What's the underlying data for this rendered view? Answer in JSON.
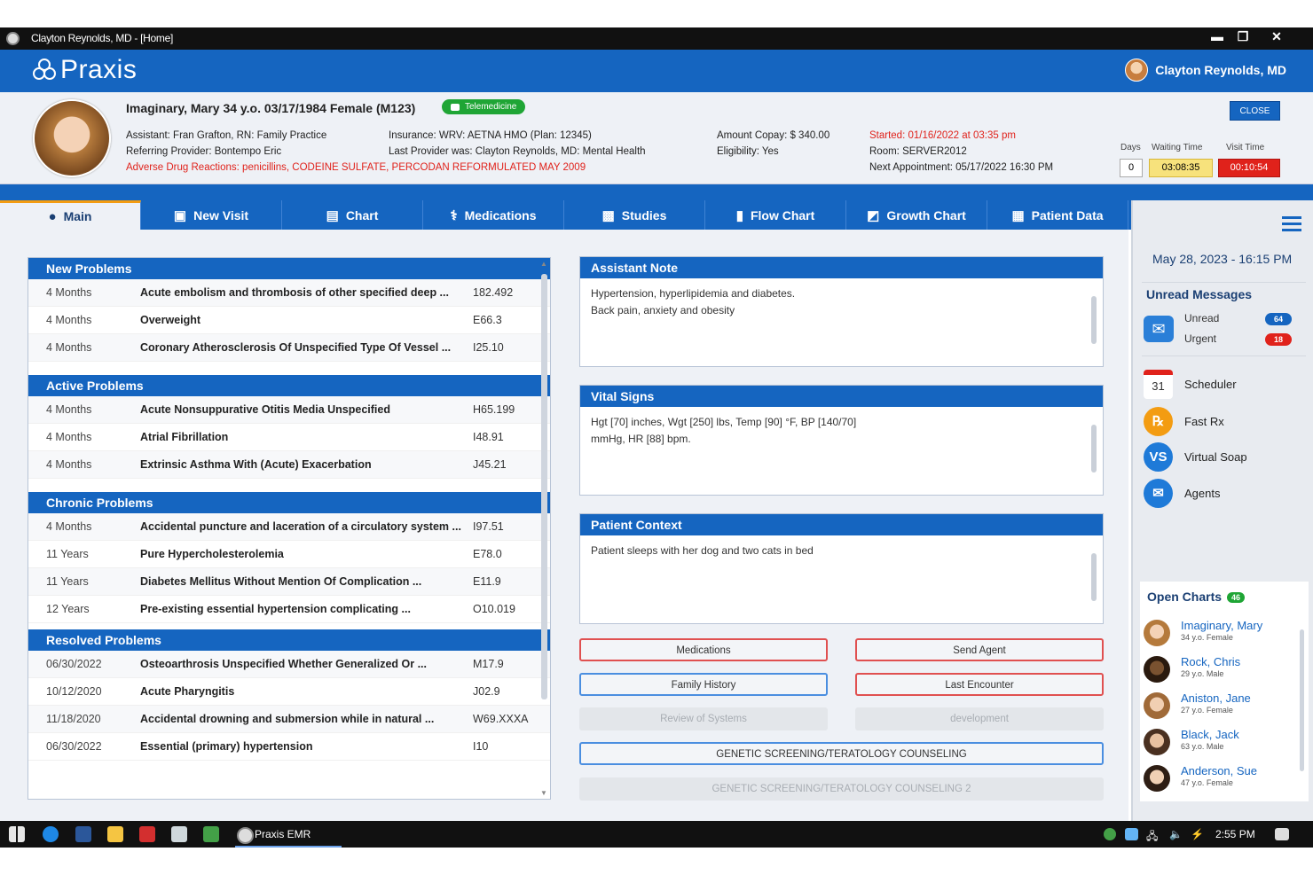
{
  "window": {
    "title": "Clayton Reynolds, MD - [Home]"
  },
  "app": {
    "logo": "Praxis",
    "user": "Clayton Reynolds, MD"
  },
  "patient": {
    "name": "Imaginary, Mary 34 y.o. 03/17/1984 Female (M123)",
    "telemedicine": "Telemedicine",
    "assistant": "Assistant: Fran Grafton, RN: Family Practice",
    "referring": "Referring Provider: Bontempo Eric",
    "adverse_label": "Adverse Drug Reactions:",
    "adverse": "penicillins, CODEINE SULFATE, PERCODAN REFORMULATED MAY 2009",
    "insurance": "Insurance: WRV: AETNA HMO (Plan: 12345)",
    "last_provider": "Last Provider was: Clayton Reynolds, MD: Mental Health",
    "copay": "Amount Copay: $ 340.00",
    "eligibility": "Eligibility: Yes",
    "started": "Started: 01/16/2022 at 03:35 pm",
    "room": "Room: SERVER2012",
    "next_appt": "Next Appointment: 05/17/2022 16:30 PM",
    "close": "CLOSE",
    "days_label": "Days",
    "days": "0",
    "waiting_label": "Waiting Time",
    "waiting": "03:08:35",
    "visit_label": "Visit Time",
    "visit": "00:10:54"
  },
  "tabs": [
    {
      "label": "Main",
      "icon": "user-icon"
    },
    {
      "label": "New Visit",
      "icon": "new-visit-icon"
    },
    {
      "label": "Chart",
      "icon": "chart-icon"
    },
    {
      "label": "Medications",
      "icon": "medications-icon"
    },
    {
      "label": "Studies",
      "icon": "studies-icon"
    },
    {
      "label": "Flow Chart",
      "icon": "bar-chart-icon"
    },
    {
      "label": "Growth Chart",
      "icon": "growth-chart-icon"
    },
    {
      "label": "Patient Data",
      "icon": "id-card-icon"
    }
  ],
  "problems": {
    "new": {
      "title": "New Problems",
      "rows": [
        [
          "4 Months",
          "Acute embolism and thrombosis of other specified deep ...",
          "182.492"
        ],
        [
          "4 Months",
          "Overweight",
          "E66.3"
        ],
        [
          "4 Months",
          "Coronary Atherosclerosis Of Unspecified Type Of Vessel ...",
          "I25.10"
        ]
      ]
    },
    "active": {
      "title": "Active Problems",
      "rows": [
        [
          "4 Months",
          "Acute Nonsuppurative Otitis Media Unspecified",
          "H65.199"
        ],
        [
          "4 Months",
          "Atrial Fibrillation",
          "I48.91"
        ],
        [
          "4 Months",
          "Extrinsic Asthma With (Acute) Exacerbation",
          "J45.21"
        ]
      ]
    },
    "chronic": {
      "title": "Chronic Problems",
      "rows": [
        [
          "4 Months",
          "Accidental puncture and laceration of a circulatory system ...",
          "I97.51"
        ],
        [
          "11 Years",
          "Pure Hypercholesterolemia",
          "E78.0"
        ],
        [
          "11 Years",
          "Diabetes Mellitus Without Mention Of Complication ...",
          "E11.9"
        ],
        [
          "12 Years",
          "Pre-existing essential hypertension complicating ...",
          "O10.019"
        ]
      ]
    },
    "resolved": {
      "title": "Resolved Problems",
      "rows": [
        [
          "06/30/2022",
          "Osteoarthrosis Unspecified Whether Generalized Or ...",
          "M17.9"
        ],
        [
          "10/12/2020",
          "Acute Pharyngitis",
          "J02.9"
        ],
        [
          "11/18/2020",
          "Accidental drowning and submersion while in natural ...",
          "W69.XXXA"
        ],
        [
          "06/30/2022",
          "Essential (primary) hypertension",
          "I10"
        ]
      ]
    }
  },
  "notes": {
    "assistant": {
      "title": "Assistant Note",
      "text1": "Hypertension, hyperlipidemia and diabetes.",
      "text2": "Back pain, anxiety and obesity"
    },
    "vitals": {
      "title": "Vital Signs",
      "text1": "Hgt [70] inches, Wgt [250] lbs, Temp [90] °F, BP [140/70]",
      "text2": "mmHg, HR [88] bpm."
    },
    "context": {
      "title": "Patient Context",
      "text1": "Patient sleeps with her dog and two cats in bed"
    }
  },
  "buttons": {
    "medications": "Medications",
    "send_agent": "Send Agent",
    "family_history": "Family History",
    "last_encounter": "Last Encounter",
    "review_systems": "Review of Systems",
    "development": "development",
    "genetic": "GENETIC SCREENING/TERATOLOGY COUNSELING",
    "genetic2": "GENETIC SCREENING/TERATOLOGY COUNSELING 2"
  },
  "sidebar": {
    "date": "May 28, 2023 - 16:15 PM",
    "unread_title": "Unread Messages",
    "unread_label": "Unread",
    "unread_count": "64",
    "urgent_label": "Urgent",
    "urgent_count": "18",
    "apps": [
      {
        "label": "Scheduler",
        "icon": "calendar-icon",
        "glyph": "31"
      },
      {
        "label": "Fast Rx",
        "icon": "rx-icon",
        "glyph": "℞"
      },
      {
        "label": "Virtual Soap",
        "icon": "vs-icon",
        "glyph": "VS"
      },
      {
        "label": "Agents",
        "icon": "agents-icon",
        "glyph": "✉"
      }
    ],
    "open_charts_title": "Open Charts",
    "open_charts_count": "46",
    "charts": [
      {
        "name": "Imaginary, Mary",
        "sub": "34 y.o. Female"
      },
      {
        "name": "Rock, Chris",
        "sub": "29 y.o. Male"
      },
      {
        "name": "Aniston, Jane",
        "sub": "27 y.o. Female"
      },
      {
        "name": "Black, Jack",
        "sub": "63 y.o. Male"
      },
      {
        "name": "Anderson, Sue",
        "sub": "47 y.o. Female"
      }
    ]
  },
  "taskbar": {
    "app": "Praxis EMR",
    "time": "2:55 PM"
  }
}
